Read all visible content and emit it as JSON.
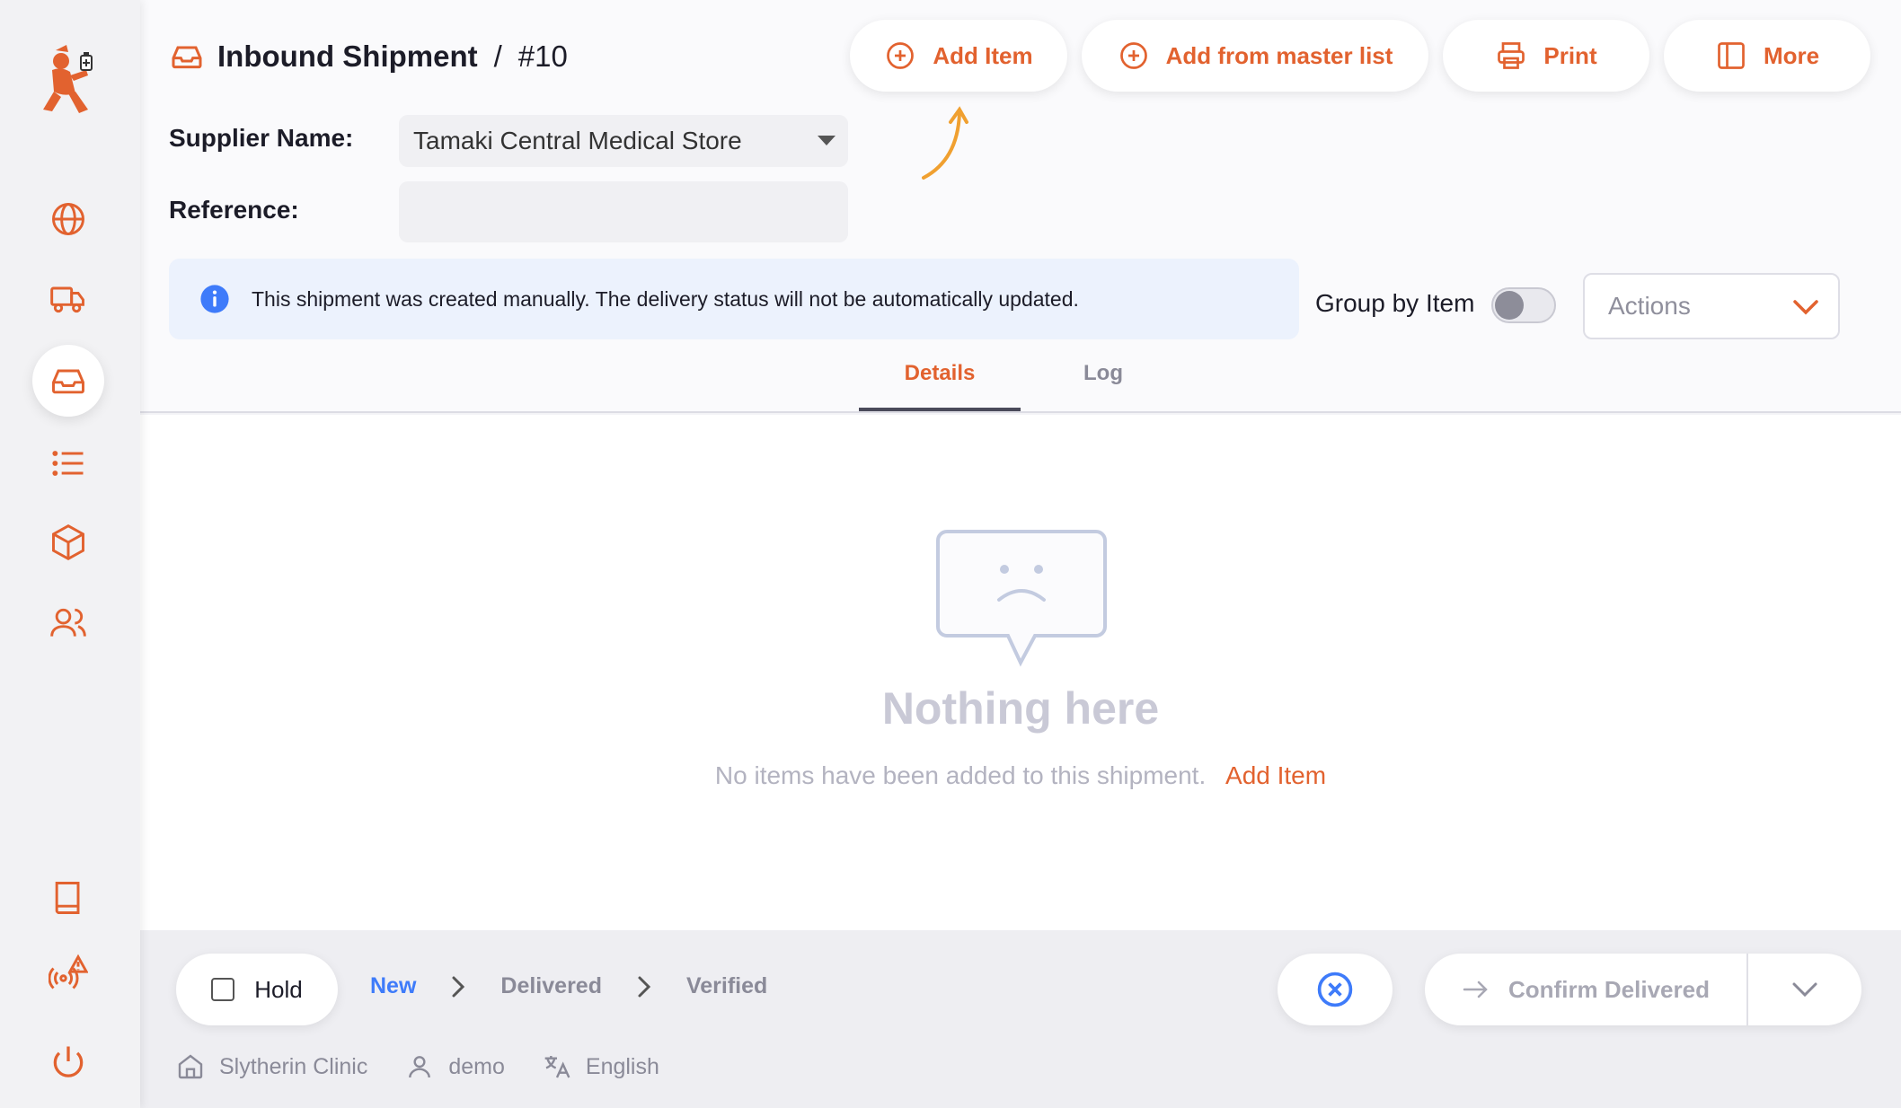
{
  "colors": {
    "accent": "#e2622f",
    "blue": "#3e7bfa",
    "info_bg": "#ecf2fd",
    "arrow": "#f0a030"
  },
  "sidebar": {
    "items": [
      {
        "name": "globe-icon"
      },
      {
        "name": "truck-icon"
      },
      {
        "name": "inbox-icon",
        "active": true
      },
      {
        "name": "list-icon"
      },
      {
        "name": "box-icon"
      },
      {
        "name": "users-icon"
      },
      {
        "name": "book-icon"
      },
      {
        "name": "sync-alert-icon"
      },
      {
        "name": "power-icon"
      }
    ]
  },
  "header": {
    "title": "Inbound Shipment",
    "separator": "/",
    "number": "#10",
    "buttons": {
      "add_item": "Add Item",
      "add_master": "Add from master list",
      "print": "Print",
      "more": "More"
    },
    "supplier_label": "Supplier Name:",
    "supplier_value": "Tamaki Central Medical Store",
    "reference_label": "Reference:",
    "reference_value": "",
    "info_text": "This shipment was created manually. The delivery status will not be automatically updated.",
    "group_by_label": "Group by Item",
    "group_by_on": false,
    "actions_label": "Actions",
    "tabs": [
      {
        "label": "Details",
        "active": true
      },
      {
        "label": "Log",
        "active": false
      }
    ]
  },
  "main": {
    "empty_title": "Nothing here",
    "empty_text": "No items have been added to this shipment.",
    "empty_link": "Add Item"
  },
  "footer": {
    "hold_label": "Hold",
    "statuses": [
      "New",
      "Delivered",
      "Verified"
    ],
    "current_status": "New",
    "confirm_label": "Confirm Delivered",
    "store": "Slytherin Clinic",
    "user": "demo",
    "language": "English"
  }
}
